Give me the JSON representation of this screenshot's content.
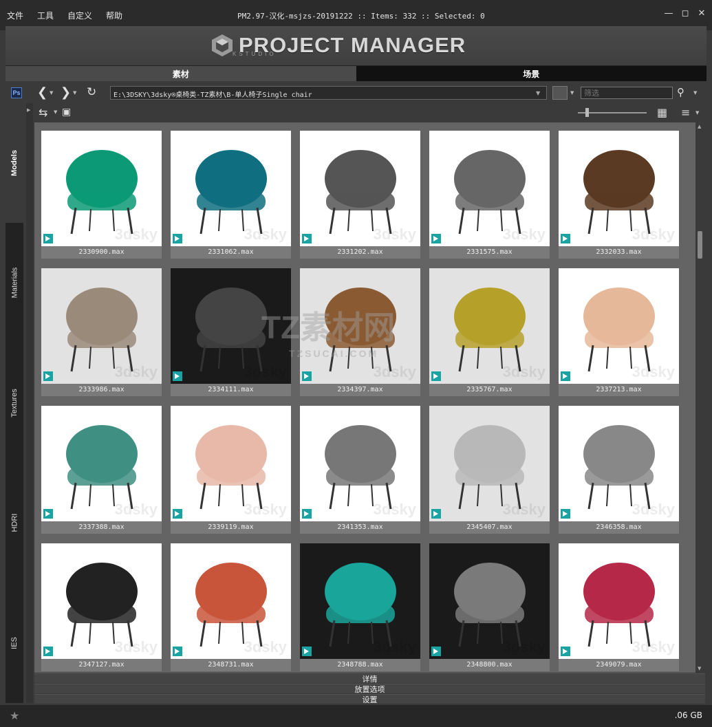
{
  "menu": [
    "文件",
    "工具",
    "自定义",
    "帮助"
  ],
  "window_title": "PM2.97-汉化-msjzs-20191222  :: Items: 332  :: Selected: 0",
  "logo": {
    "text": "PROJECT MANAGER",
    "sub": "KSTUDIO"
  },
  "tabs": [
    {
      "label": "素材"
    },
    {
      "label": "场景"
    }
  ],
  "address": {
    "ps_label": "Ps",
    "path": "E:\\3DSKY\\3dsky®桌椅类-TZ素材\\B-单人椅子Single chair",
    "filter_placeholder": "筛选"
  },
  "sidebar": [
    {
      "label": "Models"
    },
    {
      "label": "Materials"
    },
    {
      "label": "Textures"
    },
    {
      "label": "HDRI"
    },
    {
      "label": "IES"
    }
  ],
  "items": [
    {
      "name": "2330900.max",
      "color": "#0b9a75",
      "bg": "white"
    },
    {
      "name": "2331062.max",
      "color": "#0f6f80",
      "bg": "white"
    },
    {
      "name": "2331202.max",
      "color": "#555555",
      "bg": "white"
    },
    {
      "name": "2331575.max",
      "color": "#666666",
      "bg": "white"
    },
    {
      "name": "2332033.max",
      "color": "#5a3a22",
      "bg": "white"
    },
    {
      "name": "2333986.max",
      "color": "#9a8a7a",
      "bg": "gray"
    },
    {
      "name": "2334111.max",
      "color": "#444444",
      "bg": "dark"
    },
    {
      "name": "2334397.max",
      "color": "#8a5a33",
      "bg": "gray"
    },
    {
      "name": "2335767.max",
      "color": "#b5a12a",
      "bg": "gray"
    },
    {
      "name": "2337213.max",
      "color": "#e6b89a",
      "bg": "white"
    },
    {
      "name": "2337388.max",
      "color": "#3f8f82",
      "bg": "white"
    },
    {
      "name": "2339119.max",
      "color": "#e8b8a8",
      "bg": "white"
    },
    {
      "name": "2341353.max",
      "color": "#777777",
      "bg": "white"
    },
    {
      "name": "2345407.max",
      "color": "#b8b8b8",
      "bg": "gray"
    },
    {
      "name": "2346358.max",
      "color": "#888888",
      "bg": "white"
    },
    {
      "name": "2347127.max",
      "color": "#222222",
      "bg": "white"
    },
    {
      "name": "2348731.max",
      "color": "#c8553a",
      "bg": "white"
    },
    {
      "name": "2348788.max",
      "color": "#1aa59a",
      "bg": "dark"
    },
    {
      "name": "2348800.max",
      "color": "#7a7a7a",
      "bg": "dark"
    },
    {
      "name": "2349079.max",
      "color": "#b52848",
      "bg": "white"
    }
  ],
  "watermark": {
    "small": "3dsky",
    "big_cn": "TZ素材网",
    "big_en": "TZSUCAI.COM"
  },
  "panels": {
    "details": "详情",
    "placement": "放置选项",
    "settings": "设置"
  },
  "status": {
    "disk": ".06 GB"
  }
}
